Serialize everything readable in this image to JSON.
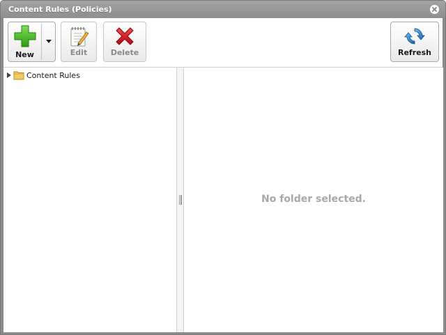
{
  "window": {
    "title": "Content Rules (Policies)"
  },
  "toolbar": {
    "new_label": "New",
    "edit_label": "Edit",
    "delete_label": "Delete",
    "refresh_label": "Refresh"
  },
  "tree": {
    "items": [
      {
        "label": "Content Rules",
        "icon": "folder-icon",
        "expanded": false
      }
    ]
  },
  "content": {
    "empty_message": "No folder selected."
  },
  "colors": {
    "titlebar": "#9a9a9a",
    "frame": "#8c8c8c",
    "new_icon": "#3aa51a",
    "delete_icon": "#c8141a",
    "refresh_icon": "#1f7fd0",
    "folder_icon": "#f2c863",
    "muted_text": "#a8a8a8"
  }
}
